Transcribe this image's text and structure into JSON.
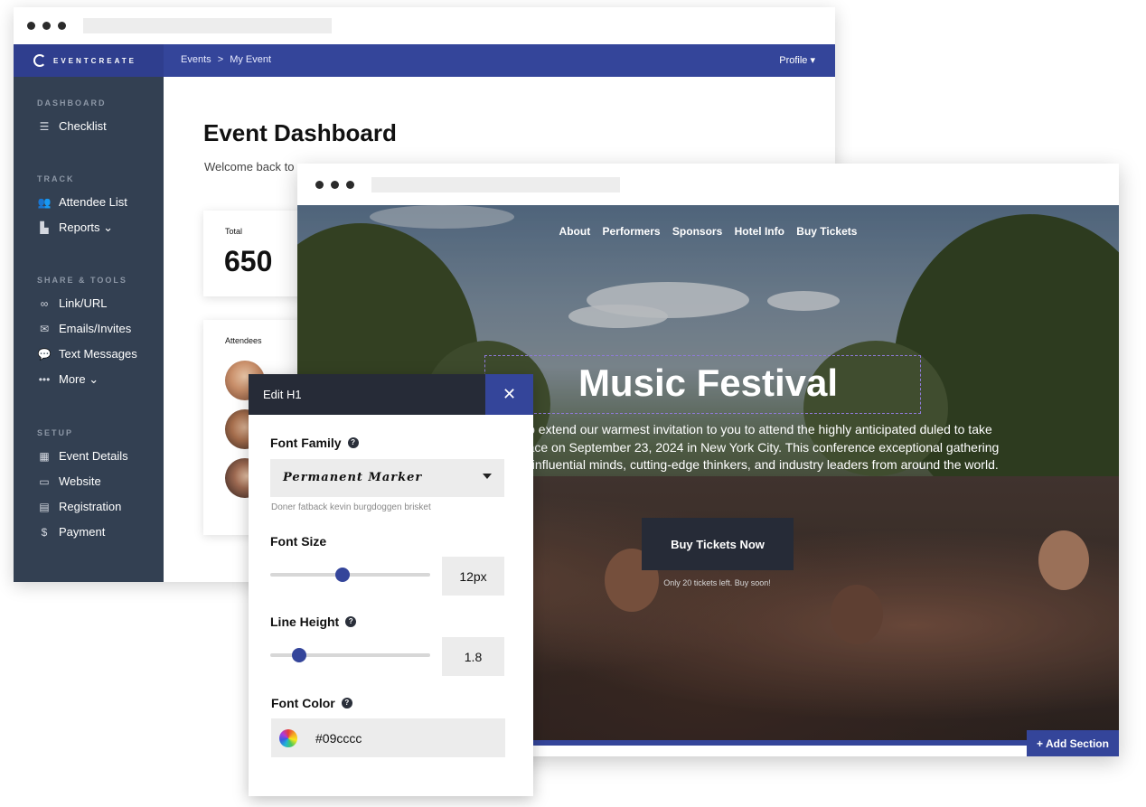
{
  "dashboard": {
    "brand": "EVENTCREATE",
    "breadcrumb": [
      "Events",
      ">",
      "My Event"
    ],
    "profile": "Profile ▾",
    "sidebar": {
      "sections": [
        {
          "label": "DASHBOARD",
          "items": [
            {
              "icon": "checklist-icon",
              "glyph": "☰",
              "label": "Checklist"
            }
          ]
        },
        {
          "label": "TRACK",
          "items": [
            {
              "icon": "users-icon",
              "glyph": "👥",
              "label": "Attendee List"
            },
            {
              "icon": "bar-chart-icon",
              "glyph": "▙",
              "label": "Reports ⌄"
            }
          ]
        },
        {
          "label": "SHARE & TOOLS",
          "items": [
            {
              "icon": "link-icon",
              "glyph": "∞",
              "label": "Link/URL"
            },
            {
              "icon": "mail-icon",
              "glyph": "✉",
              "label": "Emails/Invites"
            },
            {
              "icon": "chat-icon",
              "glyph": "💬",
              "label": "Text Messages"
            },
            {
              "icon": "more-icon",
              "glyph": "•••",
              "label": "More ⌄"
            }
          ]
        },
        {
          "label": "SETUP",
          "items": [
            {
              "icon": "calendar-icon",
              "glyph": "▦",
              "label": "Event Details"
            },
            {
              "icon": "monitor-icon",
              "glyph": "▭",
              "label": "Website"
            },
            {
              "icon": "clipboard-icon",
              "glyph": "▤",
              "label": "Registration"
            },
            {
              "icon": "dollar-icon",
              "glyph": "$",
              "label": "Payment"
            }
          ]
        }
      ]
    },
    "title": "Event Dashboard",
    "welcome": "Welcome back to",
    "total_card": {
      "label": "Total",
      "value": "650"
    },
    "attendees_card": {
      "label": "Attendees"
    }
  },
  "website": {
    "nav": [
      "About",
      "Performers",
      "Sponsors",
      "Hotel Info",
      "Buy Tickets"
    ],
    "hero_title": "Music Festival",
    "hero_text": "to extend our warmest invitation to you to attend the highly anticipated duled to take place on September 23, 2024 in New York City. This conference exceptional gathering of influential minds, cutting-edge thinkers, and industry leaders from around the world.",
    "cta": "Buy Tickets Now",
    "cta_note": "Only 20 tickets left. Buy soon!",
    "add_section": "+ Add Section"
  },
  "editor": {
    "title": "Edit H1",
    "close": "✕",
    "font_family": {
      "label": "Font Family",
      "value": "Permanent Marker",
      "hint": "Doner fatback kevin burgdoggen brisket"
    },
    "font_size": {
      "label": "Font Size",
      "value": "12px",
      "level": 0.45
    },
    "line_height": {
      "label": "Line Height",
      "value": "1.8",
      "level": 0.15
    },
    "font_color": {
      "label": "Font Color",
      "value": "#09cccc"
    }
  },
  "colors": {
    "primary": "#34459a",
    "sidebar": "#334052",
    "dark": "#262b37"
  }
}
